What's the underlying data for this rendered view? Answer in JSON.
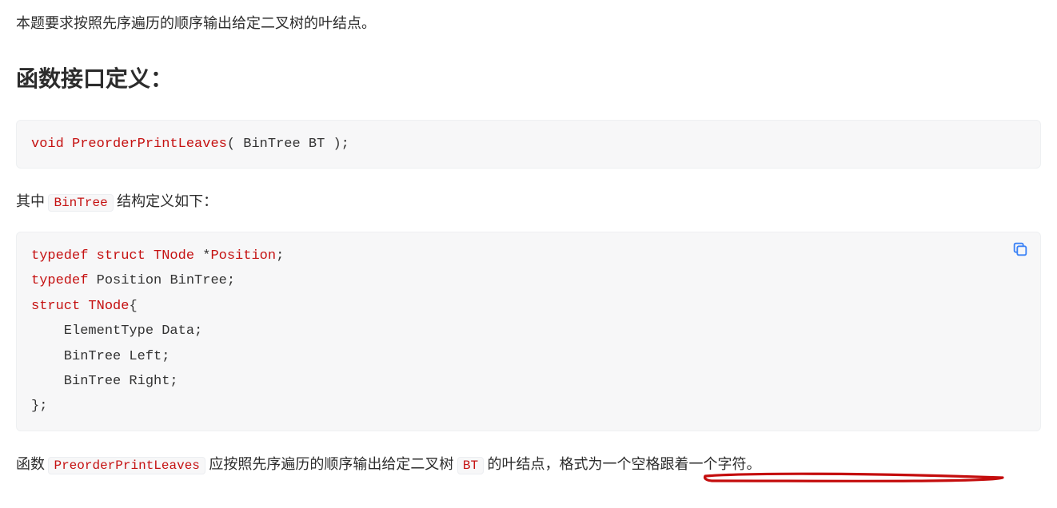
{
  "intro": "本题要求按照先序遍历的顺序输出给定二叉树的叶结点。",
  "section_title": "函数接口定义：",
  "signature": {
    "keyword": "void",
    "funcname": "PreorderPrintLeaves",
    "params": "( BinTree BT );"
  },
  "between_text_pre": "其中 ",
  "between_inline": "BinTree",
  "between_text_post": " 结构定义如下：",
  "struct_code": {
    "line1_kw": "typedef struct",
    "line1_tail_typename": "TNode",
    "line1_tail_star": " *",
    "line1_tail_position": "Position",
    "line1_tail_semi": ";",
    "line2_kw": "typedef",
    "line2_tail": " Position BinTree;",
    "line3_kw": "struct",
    "line3_tail_name": "TNode",
    "line3_tail_brace": "{",
    "line4": "    ElementType Data;",
    "line5": "    BinTree Left;",
    "line6": "    BinTree Right;",
    "line7": "};"
  },
  "final": {
    "pre": "函数 ",
    "fn_inline": "PreorderPrintLeaves",
    "mid1": " 应按照先序遍历的顺序输出给定二叉树 ",
    "bt_inline": "BT",
    "mid2": " 的叶结点，格式为一个空格跟着一个字符。"
  }
}
